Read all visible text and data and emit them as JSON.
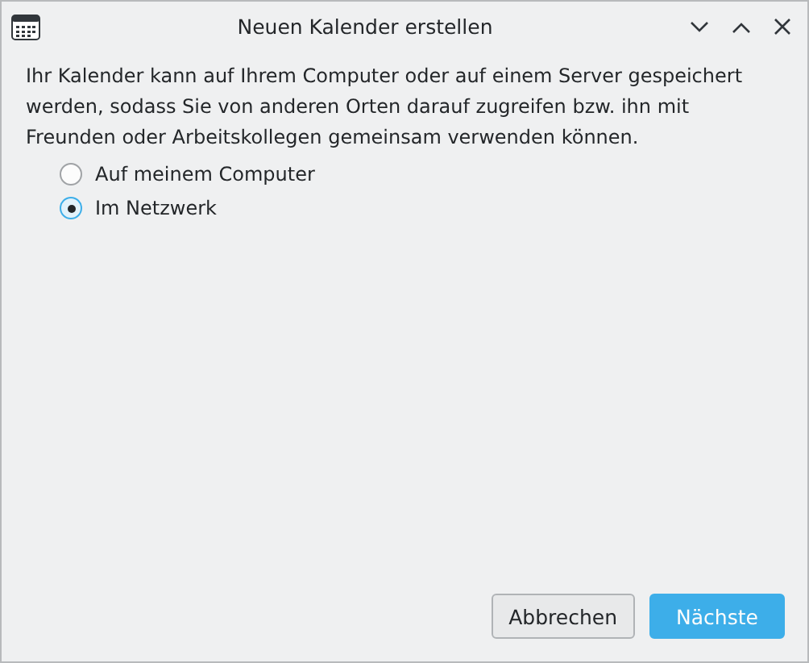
{
  "window": {
    "title": "Neuen Kalender erstellen"
  },
  "description": "Ihr Kalender kann auf Ihrem Computer oder auf einem Server gespeichert werden, sodass Sie von anderen Orten darauf zugreifen bzw. ihn mit Freunden oder Arbeitskollegen gemeinsam verwenden können.",
  "options": [
    {
      "label": "Auf meinem Computer",
      "selected": false
    },
    {
      "label": "Im Netzwerk",
      "selected": true
    }
  ],
  "buttons": [
    {
      "label": "Abbrechen",
      "kind": "normal"
    },
    {
      "label": "Nächste",
      "kind": "default"
    }
  ]
}
